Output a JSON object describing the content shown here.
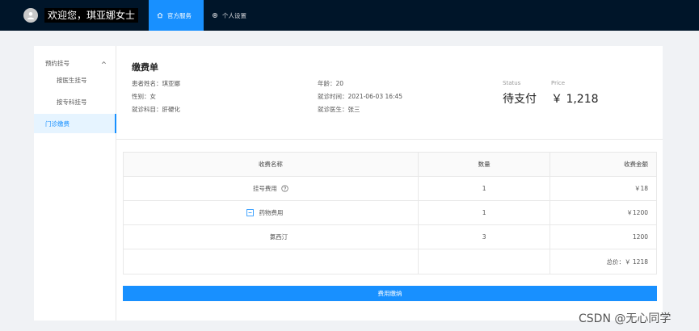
{
  "header": {
    "greeting": "欢迎您，琪亚娜女士",
    "tabs": [
      {
        "label": "官方服务",
        "icon": "home-icon",
        "active": true
      },
      {
        "label": "个人设置",
        "icon": "gear-icon",
        "active": false
      }
    ]
  },
  "sidebar": {
    "group_label": "预约挂号",
    "items": [
      {
        "label": "按医生挂号",
        "active": false
      },
      {
        "label": "按专科挂号",
        "active": false
      },
      {
        "label": "门诊缴费",
        "active": true
      }
    ]
  },
  "bill": {
    "title": "缴费单",
    "patient_name": "患者姓名：琪亚娜",
    "gender": "性别：女",
    "department": "就诊科目：肝硬化",
    "age": "年龄：20",
    "visit_time": "就诊时间：2021-06-03 16:45",
    "doctor": "就诊医生：张三",
    "status_label": "Status",
    "status_value": "待支付",
    "price_label": "Price",
    "price_value": "￥ 1,218"
  },
  "table": {
    "headers": [
      "收费名称",
      "数量",
      "收费金额"
    ],
    "rows": [
      {
        "name": "挂号费用",
        "qty": "1",
        "amount": "￥18"
      },
      {
        "name": "药物费用",
        "qty": "1",
        "amount": "￥1200"
      },
      {
        "name": "氯西汀",
        "qty": "3",
        "amount": "1200"
      }
    ],
    "total": "总价：￥ 1218"
  },
  "pay_button": "费用缴纳",
  "watermark": "CSDN @无心同学",
  "colors": {
    "accent": "#1890ff",
    "nav_bg": "#001529"
  }
}
